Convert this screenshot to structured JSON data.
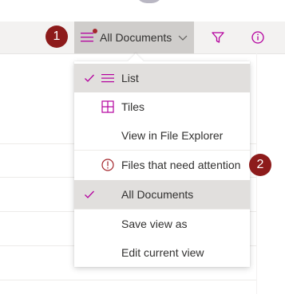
{
  "callouts": [
    "1",
    "2"
  ],
  "command_bar": {
    "view_label": "All Documents",
    "icons": [
      "view-lines-icon",
      "chevron-down-icon",
      "filter-icon",
      "info-icon"
    ],
    "notification_dot_color": "#a4262c"
  },
  "menu": {
    "items": [
      {
        "label": "List",
        "icon": "list-icon",
        "checked": true,
        "selected": true
      },
      {
        "label": "Tiles",
        "icon": "tiles-icon",
        "checked": false,
        "selected": false
      },
      {
        "label": "View in File Explorer",
        "icon": "",
        "checked": false,
        "selected": false
      },
      {
        "label": "Files that need attention",
        "icon": "alert-circle-icon",
        "checked": false,
        "selected": false
      },
      {
        "label": "All Documents",
        "icon": "",
        "checked": true,
        "selected": true
      },
      {
        "label": "Save view as",
        "icon": "",
        "checked": false,
        "selected": false
      },
      {
        "label": "Edit current view",
        "icon": "",
        "checked": false,
        "selected": false
      }
    ]
  },
  "colors": {
    "accent": "#b4009e",
    "callout": "#8d1b1b",
    "selected_bg": "#e1dfdd",
    "command_bar_bg": "#f3f2f1"
  }
}
